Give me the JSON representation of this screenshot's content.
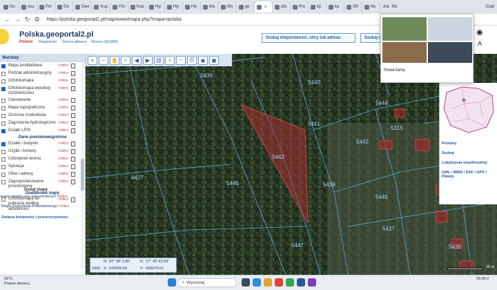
{
  "browser": {
    "tabs": [
      {
        "label": "No"
      },
      {
        "label": "ocu"
      },
      {
        "label": "Pol"
      },
      {
        "label": "Go"
      },
      {
        "label": "Geo"
      },
      {
        "label": "Kup"
      },
      {
        "label": "FAI"
      },
      {
        "label": "Kup"
      },
      {
        "label": "Hyı"
      },
      {
        "label": "Hyı"
      },
      {
        "label": "Hyı"
      },
      {
        "label": "Ma"
      },
      {
        "label": "Wo"
      },
      {
        "label": "ge"
      },
      {
        "label": ""
      },
      {
        "label": "ulic"
      },
      {
        "label": "Pro"
      },
      {
        "label": "kp"
      },
      {
        "label": "kp"
      },
      {
        "label": "SR"
      },
      {
        "label": "No"
      }
    ],
    "active_tab_label": "",
    "url": "https://polska.geoportal2.pl/map/www/mapa.php?mapa=polska",
    "popup_tab_label": "zra",
    "popup_tab2": "No",
    "popup_caption": "Nowa karta",
    "popup_right_label": "Czat"
  },
  "site": {
    "title": "Polska.geoportal2.pl",
    "help": "Pomoc",
    "links": [
      "Regulamin",
      "Strona główna",
      "Strona GEOBID"
    ],
    "search_place": "Szukaj miejscowości, ulicy lub adresu",
    "search_other": "Szukaj d"
  },
  "sidebar": {
    "header": "Warstwy",
    "info_label": "<Info>",
    "layers": [
      {
        "label": "Mapa podkładowa",
        "checked": true
      },
      {
        "label": "Podział administracyjny",
        "checked": false
      },
      {
        "label": "Ortofotomapa",
        "checked": false
      },
      {
        "label": "Ortofotomapa wysokiej rozdzielczości",
        "checked": true
      },
      {
        "label": "Cieniowanie",
        "checked": false
      },
      {
        "label": "Mapa topograficzna",
        "checked": false
      },
      {
        "label": "Ochrona środowiska",
        "checked": false
      },
      {
        "label": "Zagrożenia hydrologiczne",
        "checked": false
      },
      {
        "label": "Działki LPIS",
        "checked": true
      }
    ],
    "section_gminne": "Dane powiatowe/gminne",
    "layers2": [
      {
        "label": "Działki i budynki",
        "checked": true
      },
      {
        "label": "Użytki i kontury",
        "checked": false
      },
      {
        "label": "Uzbrojenie terenu",
        "checked": false
      },
      {
        "label": "Sytuacja",
        "checked": false
      },
      {
        "label": "Ulice i adresy",
        "checked": false
      },
      {
        "label": "Zagospodarowanie przestrzenne",
        "checked": false
      }
    ],
    "section_dodatkowe": "Dodatkowe mapy",
    "layers3": [
      {
        "label": "Ortofotomapa do pobrania według aktualności",
        "checked": false
      }
    ],
    "add_map_title": "Dodaj mapę",
    "add_maps": [
      {
        "label": "mapa rejestru cen nieruchomości",
        "info": "<Info>"
      },
      {
        "label": "Mapa Zagrożenia Powodziowego",
        "info": "<Info>"
      }
    ],
    "joins": "Zmiana kolejności i przezroczystości"
  },
  "map": {
    "parcels": [
      "5439",
      "5440",
      "5444",
      "5441",
      "5442",
      "5443",
      "4427",
      "5446",
      "5438",
      "5445",
      "5447",
      "5437",
      "5315",
      "5436"
    ],
    "coords": {
      "n_label": "N:",
      "n_value": "52° 48' 2.86\"",
      "e_label": "E:",
      "e_value": "17° 49' 43.99\"",
      "x_label": "X:",
      "x_value": "543439.64",
      "y_label": "Y:",
      "y_value": "420970.61",
      "epsg": "1992"
    },
    "scale": "20 m"
  },
  "right_panel": {
    "links": [
      "Pomiary",
      "Szukaj",
      "Lokalizacja współrzędnej",
      "GML / WMS / DXF / GPX / Pikiety"
    ]
  },
  "taskbar": {
    "search": "Wyszukaj",
    "weather_temp": "59°C",
    "weather_desc": "Prawie słonecz.",
    "time": "",
    "date": "29.06.2"
  },
  "colors": {
    "accent": "#1d3b6e",
    "info": "#c0392b",
    "selected_parcel": "#b8343a"
  }
}
